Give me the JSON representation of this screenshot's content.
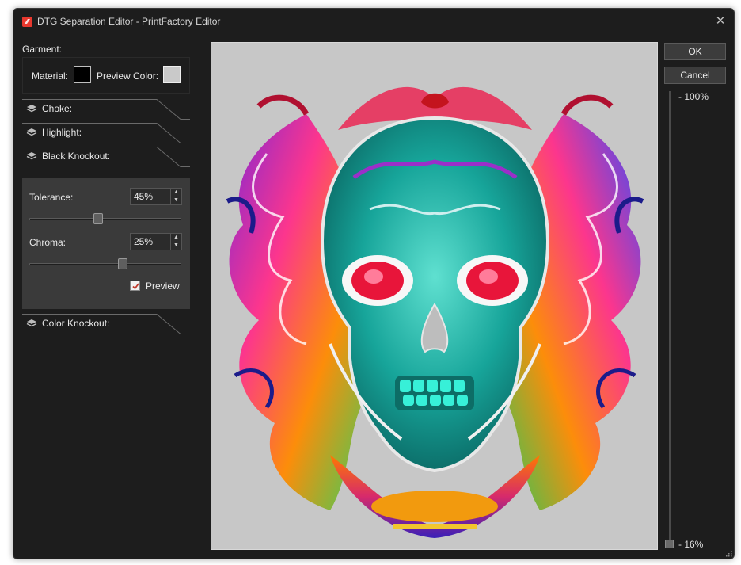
{
  "window": {
    "title": "DTG Separation Editor - PrintFactory Editor",
    "accent_icon_color": "#e8382e"
  },
  "garment": {
    "label": "Garment:",
    "material_label": "Material:",
    "material_color": "#000000",
    "preview_label": "Preview Color:",
    "preview_color": "#c9c9c9"
  },
  "sections": {
    "choke": "Choke:",
    "highlight": "Highlight:",
    "black_knockout": "Black Knockout:",
    "color_knockout": "Color Knockout:"
  },
  "black_knockout": {
    "tolerance_label": "Tolerance:",
    "tolerance_value": "45%",
    "tolerance_level": 0.45,
    "chroma_label": "Chroma:",
    "chroma_value": "25%",
    "chroma_level": 0.62,
    "preview_label": "Preview",
    "preview_checked": true
  },
  "buttons": {
    "ok": "OK",
    "cancel": "Cancel"
  },
  "zoom": {
    "max_label": "- 100%",
    "current_label": "- 16%"
  },
  "canvas": {
    "background": "#c7c7c7"
  }
}
